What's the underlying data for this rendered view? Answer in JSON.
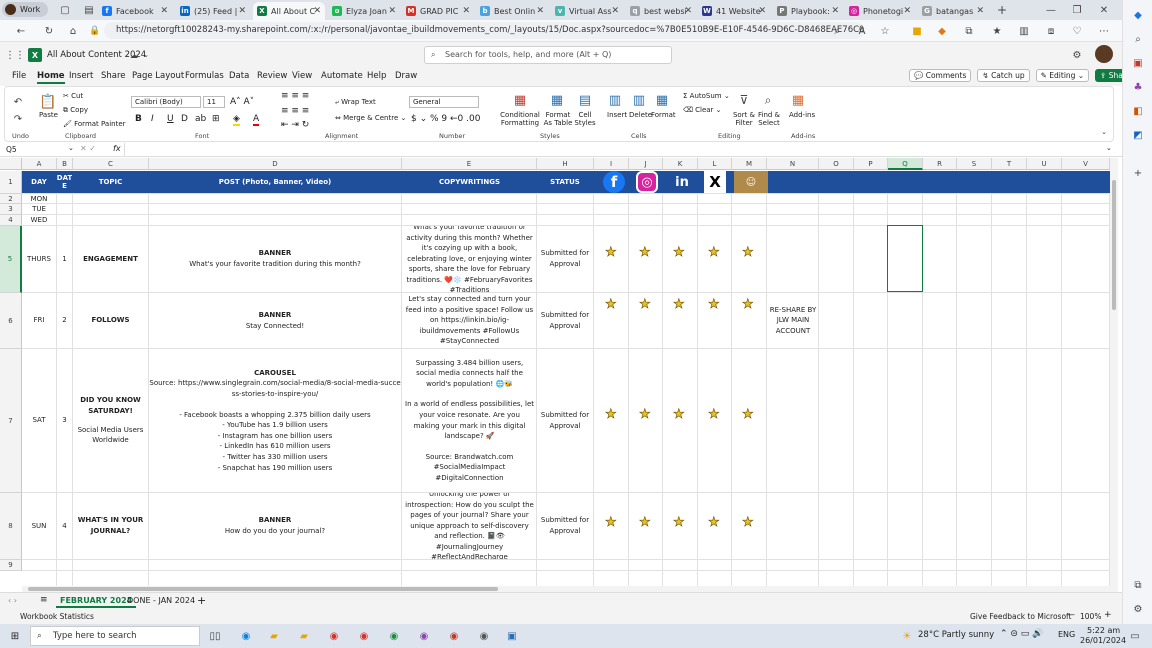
{
  "browser": {
    "profile": "Work",
    "tabs": [
      {
        "label": "Facebook",
        "color": "#1877f2",
        "glyph": "f"
      },
      {
        "label": "(25) Feed |",
        "color": "#0a66c2",
        "glyph": "in"
      },
      {
        "label": "All About C",
        "color": "#107c41",
        "glyph": "X",
        "active": true
      },
      {
        "label": "Elyza Joan",
        "color": "#1db954",
        "glyph": "o"
      },
      {
        "label": "GRAD PIC",
        "color": "#d93025",
        "glyph": "M"
      },
      {
        "label": "Best Onlin",
        "color": "#4aa3df",
        "glyph": "b"
      },
      {
        "label": "Virtual Ass",
        "color": "#4db6ac",
        "glyph": "v"
      },
      {
        "label": "best websi",
        "color": "#9aa0a6",
        "glyph": "q"
      },
      {
        "label": "41 Website",
        "color": "#2b3a8f",
        "glyph": "W"
      },
      {
        "label": "Playbook:",
        "color": "#777",
        "glyph": "P"
      },
      {
        "label": "Phonetogi",
        "color": "#d6249f",
        "glyph": "◎"
      },
      {
        "label": "batangas",
        "color": "#9aa0a6",
        "glyph": "G"
      }
    ],
    "url": "https://netorgft10028243-my.sharepoint.com/:x:/r/personal/javontae_ibuildmovements_com/_layouts/15/Doc.aspx?sourcedoc=%7B0E510B9E-E10F-4546-9D6C-D8468EAE76C0%7D&file=All..."
  },
  "excel": {
    "doc_title": "All About Content 2024",
    "search_placeholder": "Search for tools, help, and more (Alt + Q)",
    "menu": [
      "File",
      "Home",
      "Insert",
      "Share",
      "Page Layout",
      "Formulas",
      "Data",
      "Review",
      "View",
      "Automate",
      "Help",
      "Draw"
    ],
    "active_menu": "Home",
    "buttons": {
      "comments": "Comments",
      "catchup": "Catch up",
      "editing": "Editing",
      "share": "Share"
    },
    "ribbon": {
      "undo": "Undo",
      "paste": "Paste",
      "cut": "Cut",
      "copy": "Copy",
      "format_painter": "Format Painter",
      "clipboard": "Clipboard",
      "font_name": "Calibri (Body)",
      "font_size": "11",
      "font": "Font",
      "wrap": "Wrap Text",
      "merge": "Merge & Centre",
      "alignment": "Alignment",
      "numfmt": "General",
      "number": "Number",
      "cond": "Conditional Formatting",
      "format_table": "Format As Table",
      "cell_styles": "Cell Styles",
      "styles": "Styles",
      "insert": "Insert",
      "delete": "Delete",
      "format": "Format",
      "cells": "Cells",
      "autosum": "AutoSum",
      "clear": "Clear",
      "sort": "Sort & Filter",
      "find": "Find & Select",
      "editing": "Editing",
      "addins": "Add-ins",
      "addins_group": "Add-ins"
    },
    "name_box": "Q5",
    "fx": "fx",
    "columns": [
      "A",
      "B",
      "C",
      "D",
      "E",
      "H",
      "I",
      "J",
      "K",
      "L",
      "M",
      "N",
      "O",
      "P",
      "Q",
      "R",
      "S",
      "T",
      "U",
      "V"
    ],
    "rows": [
      "1",
      "2",
      "3",
      "4",
      "5",
      "6",
      "7",
      "8",
      "9"
    ],
    "header": {
      "day": "DAY",
      "date": "DAT E",
      "topic": "TOPIC",
      "post": "POST (Photo, Banner, Video)",
      "copy": "COPYWRITINGS",
      "status": "STATUS"
    },
    "days": {
      "r2": "MON",
      "r3": "TUE",
      "r4": "WED"
    },
    "entries": [
      {
        "day": "THURS",
        "date": "1",
        "topic": "ENGAGEMENT",
        "post_type": "BANNER",
        "post": "What's your favorite tradition during this month?",
        "copy": "What's your favorite tradition or activity during this month? Whether it's cozying up with a book, celebrating love, or enjoying winter sports, share the love for February traditions. ❤️❄️ #FebruaryFavorites #Traditions",
        "status": "Submitted for Approval",
        "note": ""
      },
      {
        "day": "FRI",
        "date": "2",
        "topic": "FOLLOWS",
        "post_type": "BANNER",
        "post": "Stay Connected!",
        "copy": "Let's stay connected and turn your feed into a positive space! Follow us on https://linkin.bio/ig-ibuildmovements #FollowUs #StayConnected",
        "status": "Submitted for Approval",
        "note": "RE-SHARE BY JLW MAIN ACCOUNT"
      },
      {
        "day": "SAT",
        "date": "3",
        "topic": "DID YOU KNOW SATURDAY!",
        "topic2": "Social Media Users Worldwide",
        "post_type": "CAROUSEL",
        "post": "Source: https://www.singlegrain.com/social-media/8-social-media-success-stories-to-inspire-you/",
        "post_list": [
          "- Facebook boasts a whopping 2.375 billion daily users",
          "- YouTube has 1.9 billion users",
          "- Instagram has one billion users",
          "- LinkedIn has 610 million users",
          "- Twitter has 330 million users",
          "- Snapchat has 190 million users"
        ],
        "copy": "Surpassing 3.484 billion users, social media connects half the world's population! 🌐🐝",
        "copy2": "In a world of endless possibilities, let your voice resonate. Are you making your mark in this digital landscape? 🚀",
        "copy3": "Source: Brandwatch.com #SocialMediaImpact #DigitalConnection",
        "status": "Submitted for Approval",
        "note": ""
      },
      {
        "day": "SUN",
        "date": "4",
        "topic": "WHAT'S IN YOUR JOURNAL?",
        "post_type": "BANNER",
        "post": "How do you do your journal?",
        "copy": "Unlocking the power of introspection: How do you sculpt the pages of your journal? Share your unique approach to self-discovery and reflection. 📓👁 #JournalingJourney #ReflectAndRecharge",
        "status": "Submitted for Approval",
        "note": ""
      }
    ],
    "sheet_tabs": [
      "FEBRUARY 2024",
      "DONE - JAN 2024"
    ],
    "active_sheet": "FEBRUARY 2024",
    "status_left": "Workbook Statistics",
    "feedback": "Give Feedback to Microsoft",
    "zoom": "100%",
    "colors": {
      "header_bg": "#1f4e9b",
      "accent": "#107c41",
      "star": "#f0c020"
    }
  },
  "taskbar": {
    "search_placeholder": "Type here to search",
    "weather": "28°C  Partly sunny",
    "lang": "ENG",
    "time": "5:22 am",
    "date": "26/01/2024"
  }
}
